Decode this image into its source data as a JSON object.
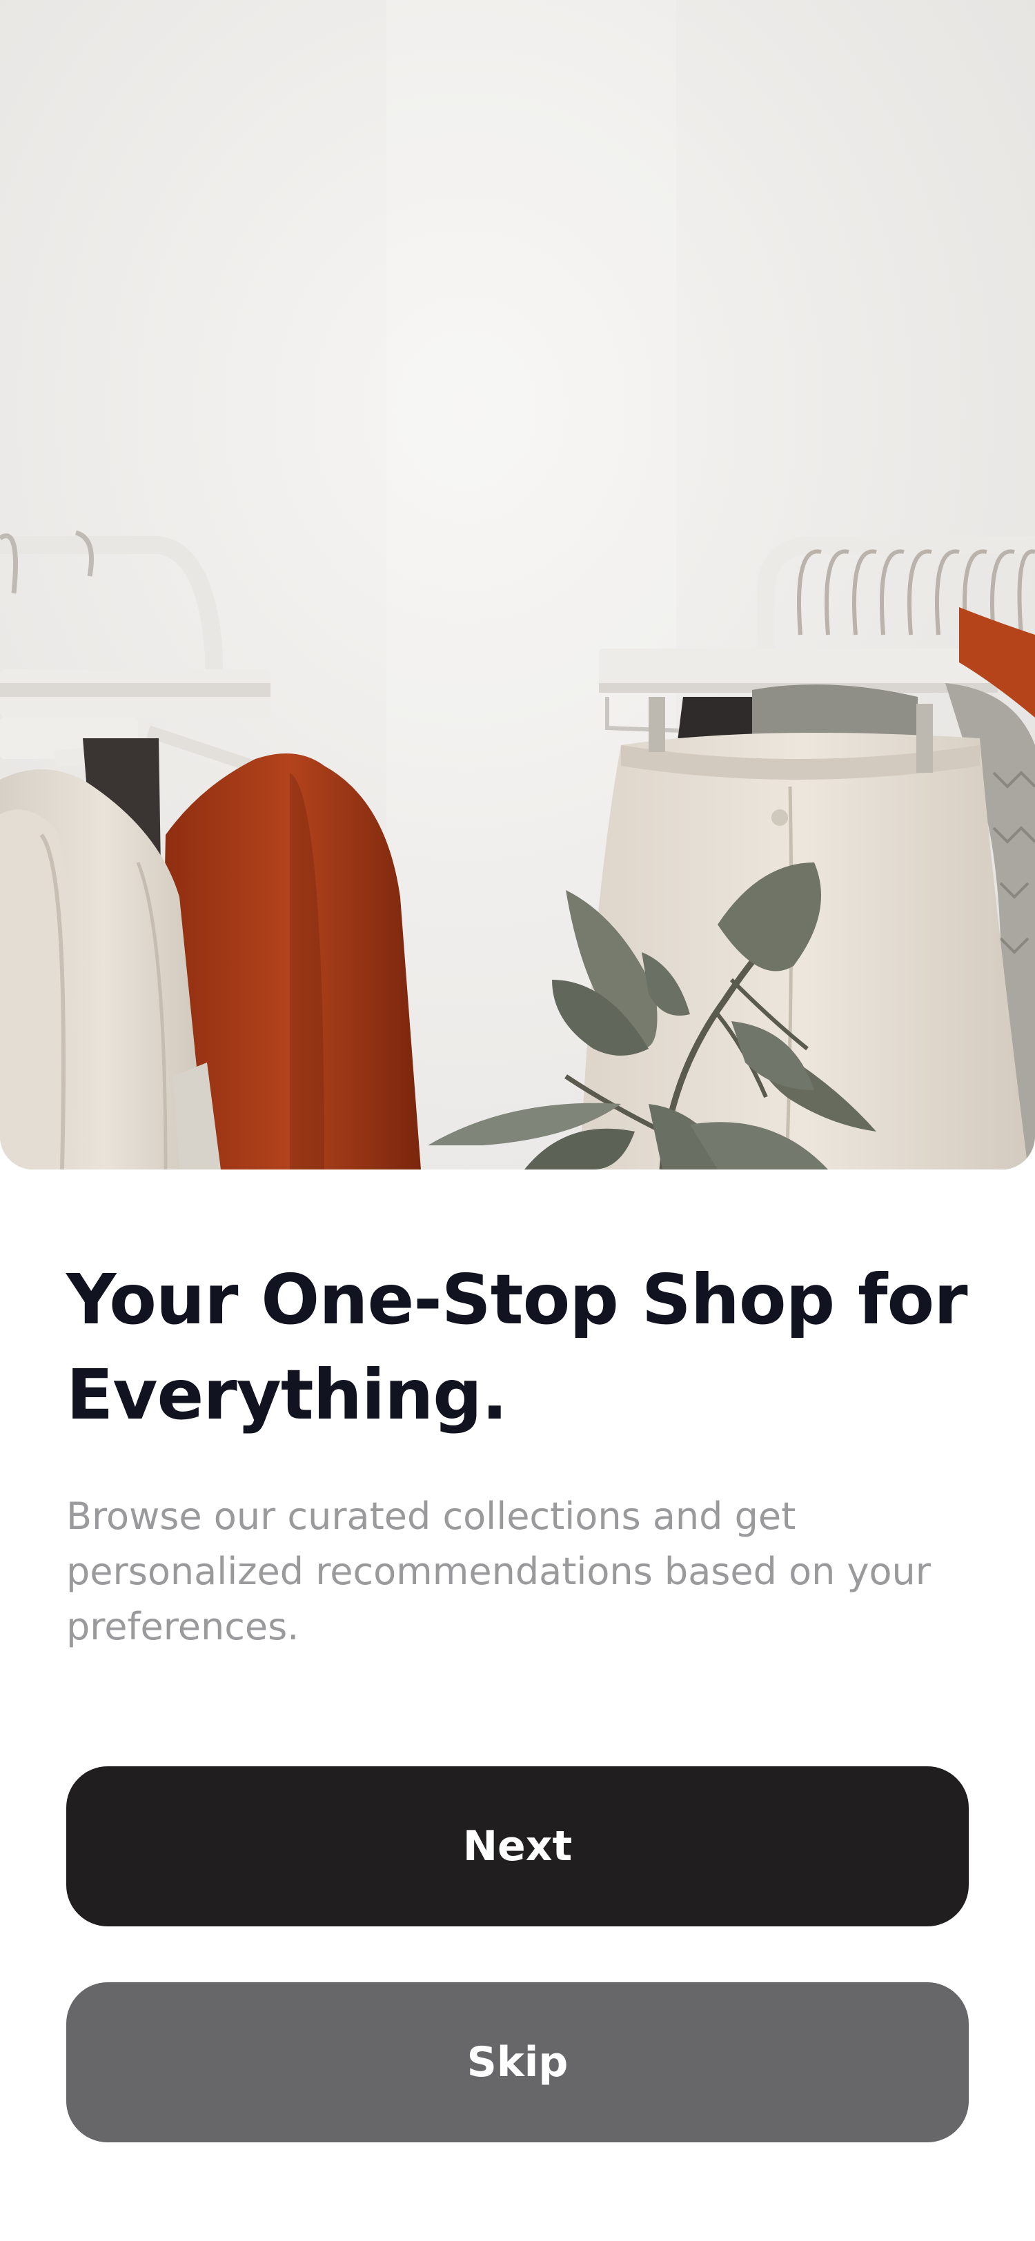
{
  "onboarding": {
    "hero_image_alt": "Clothing racks with shirts, sweaters and trousers next to a potted plant",
    "title": "Your One-Stop Shop for Everything.",
    "description": "Browse our curated collections and get personalized recommendations based on your preferences.",
    "next_label": "Next",
    "skip_label": "Skip"
  },
  "colors": {
    "primary_button": "#211e1f",
    "secondary_button": "#676769",
    "title_text": "#111320",
    "description_text": "#9a9a9c"
  }
}
